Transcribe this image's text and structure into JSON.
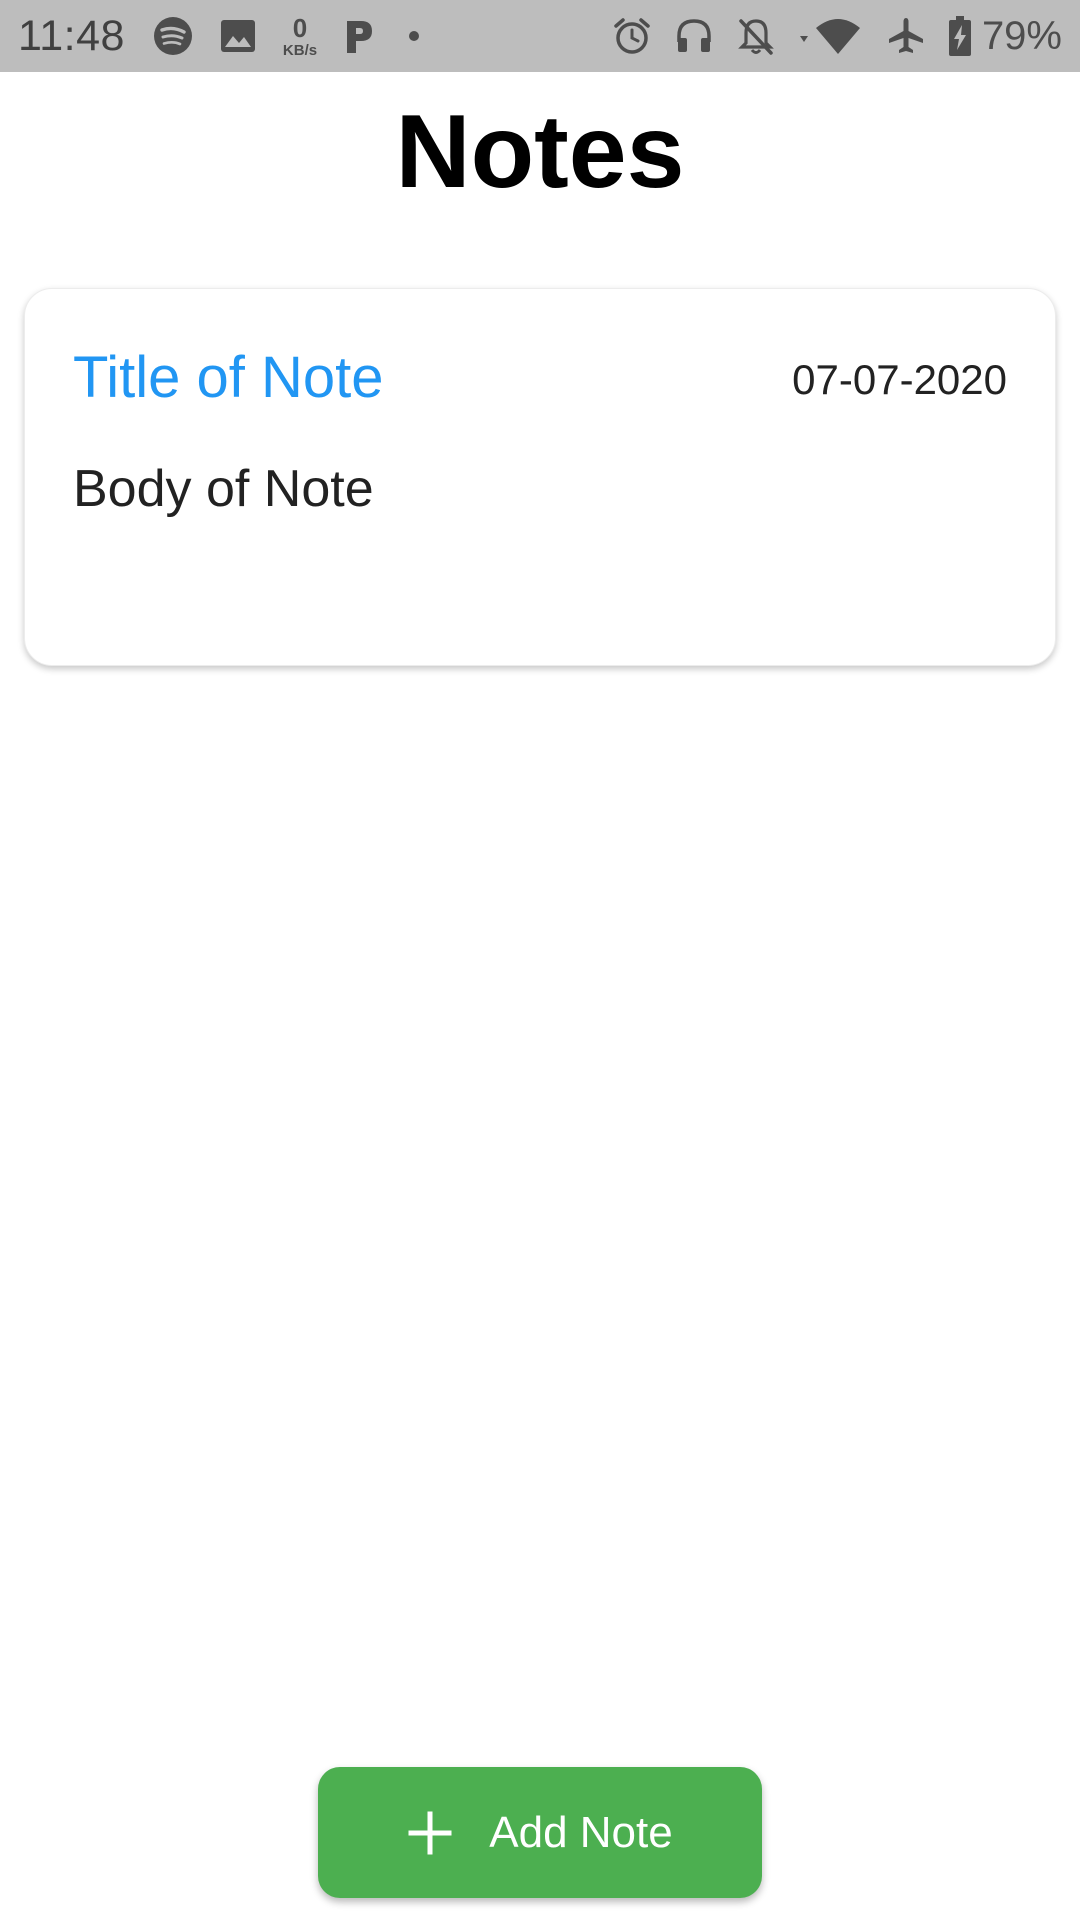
{
  "status_bar": {
    "time": "11:48",
    "net_speed_value": "0",
    "net_speed_unit": "KB/s",
    "battery_percent": "79%",
    "left_icons": [
      "spotify-icon",
      "image-icon",
      "p-app-icon",
      "dot-icon"
    ],
    "right_icons": [
      "alarm-icon",
      "headphones-icon",
      "notifications-off-icon",
      "wifi-icon",
      "airplane-icon",
      "battery-charging-icon"
    ]
  },
  "header": {
    "title": "Notes"
  },
  "notes": [
    {
      "title": "Title of Note",
      "date": "07-07-2020",
      "body": "Body of Note"
    }
  ],
  "add_button": {
    "label": "Add Note",
    "icon": "plus-icon"
  },
  "colors": {
    "status_bar_bg": "#bdbdbd",
    "note_title": "#2196f3",
    "add_button": "#4caf50",
    "text": "#222222"
  }
}
